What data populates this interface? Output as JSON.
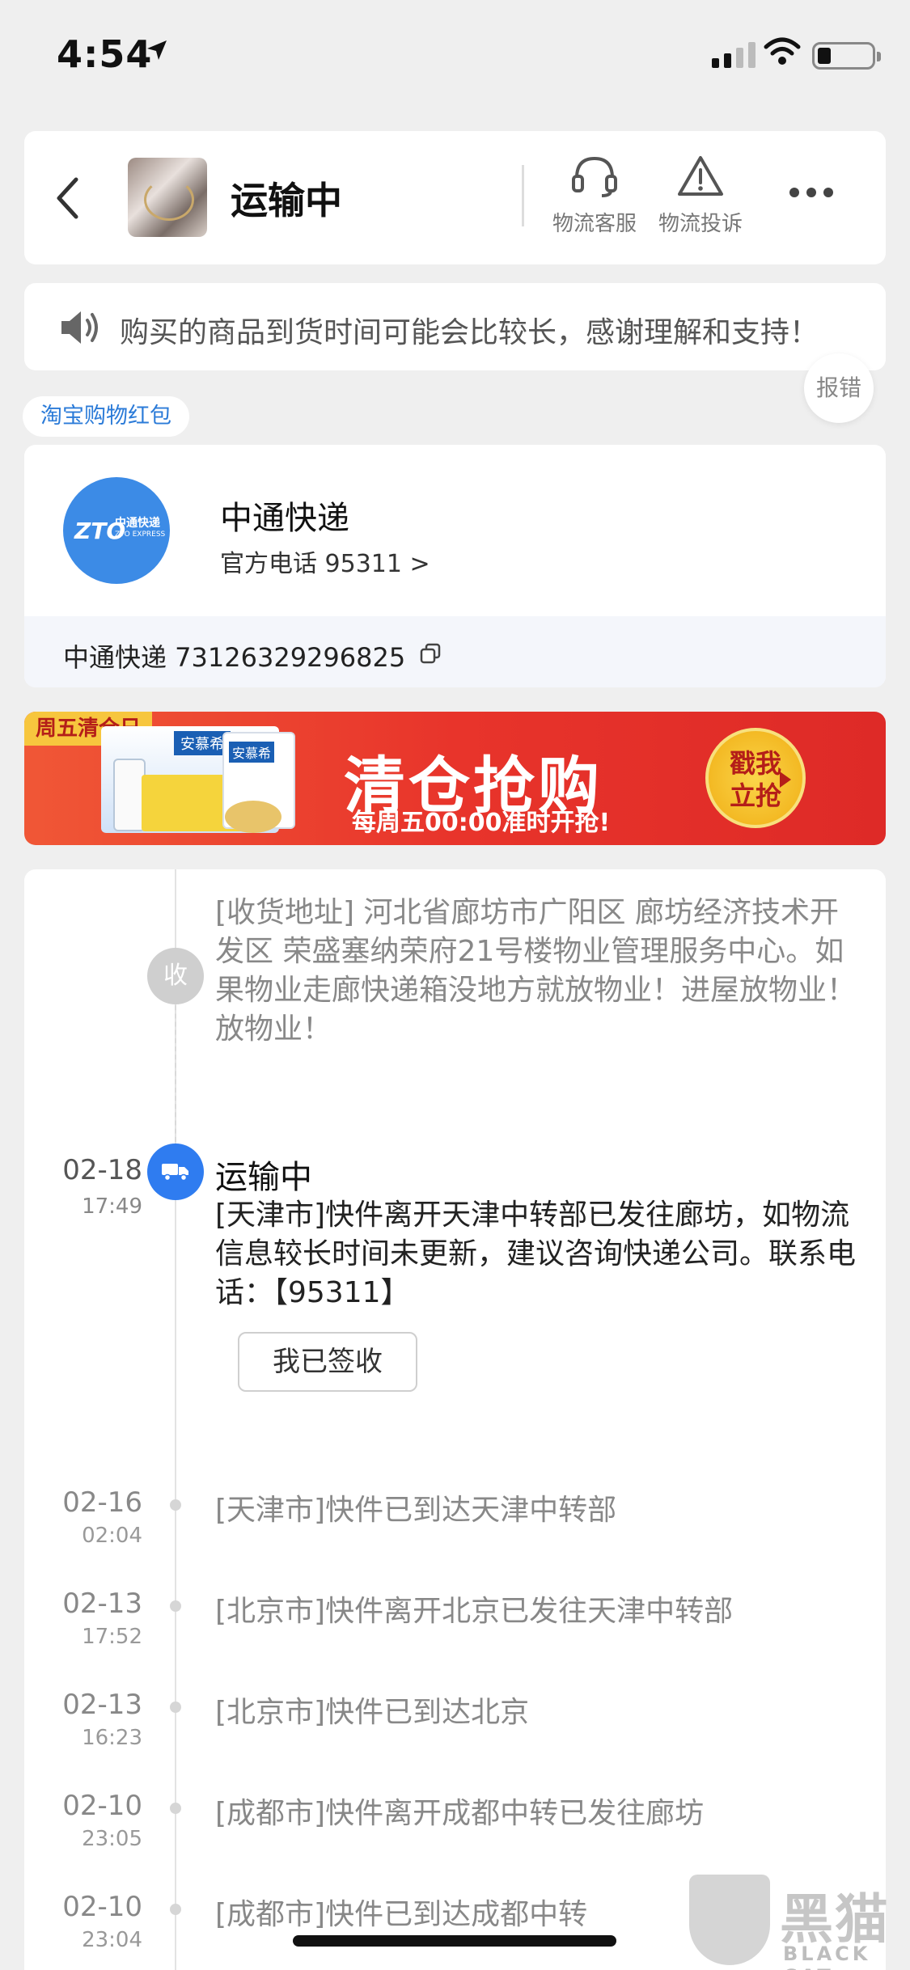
{
  "status_bar": {
    "time": "4:54"
  },
  "header": {
    "title": "运输中",
    "service_label": "物流客服",
    "complaint_label": "物流投诉"
  },
  "notice": {
    "text": "购买的商品到货时间可能会比较长，感谢理解和支持！",
    "report_label": "报错"
  },
  "red_packet_tag": "淘宝购物红包",
  "courier": {
    "name": "中通快递",
    "phone": "官方电话 95311 >",
    "tracking": "中通快递 73126329296825",
    "logo_text": "ZTO",
    "logo_cn": "中通快递",
    "logo_en": "ZTO EXPRESS"
  },
  "banner": {
    "tag": "周五清仓日",
    "brand": "安慕希",
    "title": "清仓抢购",
    "subtitle": "每周五00:00准时开抢!",
    "cta_line1": "戳我",
    "cta_line2": "立抢"
  },
  "timeline": {
    "receive_badge": "收",
    "address": "[收货地址] 河北省廊坊市广阳区  廊坊经济技术开发区  荣盛塞纳荣府21号楼物业管理服务中心。如果物业走廊快递箱没地方就放物业！进屋放物业！放物业！",
    "current": {
      "date": "02-18",
      "time": "17:49",
      "status": "运输中",
      "desc": "[天津市]快件离开天津中转部已发往廊坊，如物流信息较长时间未更新，建议咨询快递公司。联系电话：【95311】",
      "signed_button": "我已签收"
    },
    "events": [
      {
        "date": "02-16",
        "time": "02:04",
        "text": "[天津市]快件已到达天津中转部"
      },
      {
        "date": "02-13",
        "time": "17:52",
        "text": "[北京市]快件离开北京已发往天津中转部"
      },
      {
        "date": "02-13",
        "time": "16:23",
        "text": "[北京市]快件已到达北京"
      },
      {
        "date": "02-10",
        "time": "23:05",
        "text": "[成都市]快件离开成都中转已发往廊坊"
      },
      {
        "date": "02-10",
        "time": "23:04",
        "text": "[成都市]快件已到达成都中转"
      }
    ]
  },
  "watermark": {
    "cn": "黑猫",
    "en": "BLACK CAT"
  },
  "colors": {
    "accent_blue": "#2f7cf0",
    "banner_red": "#e8342b",
    "background": "#efefef"
  }
}
